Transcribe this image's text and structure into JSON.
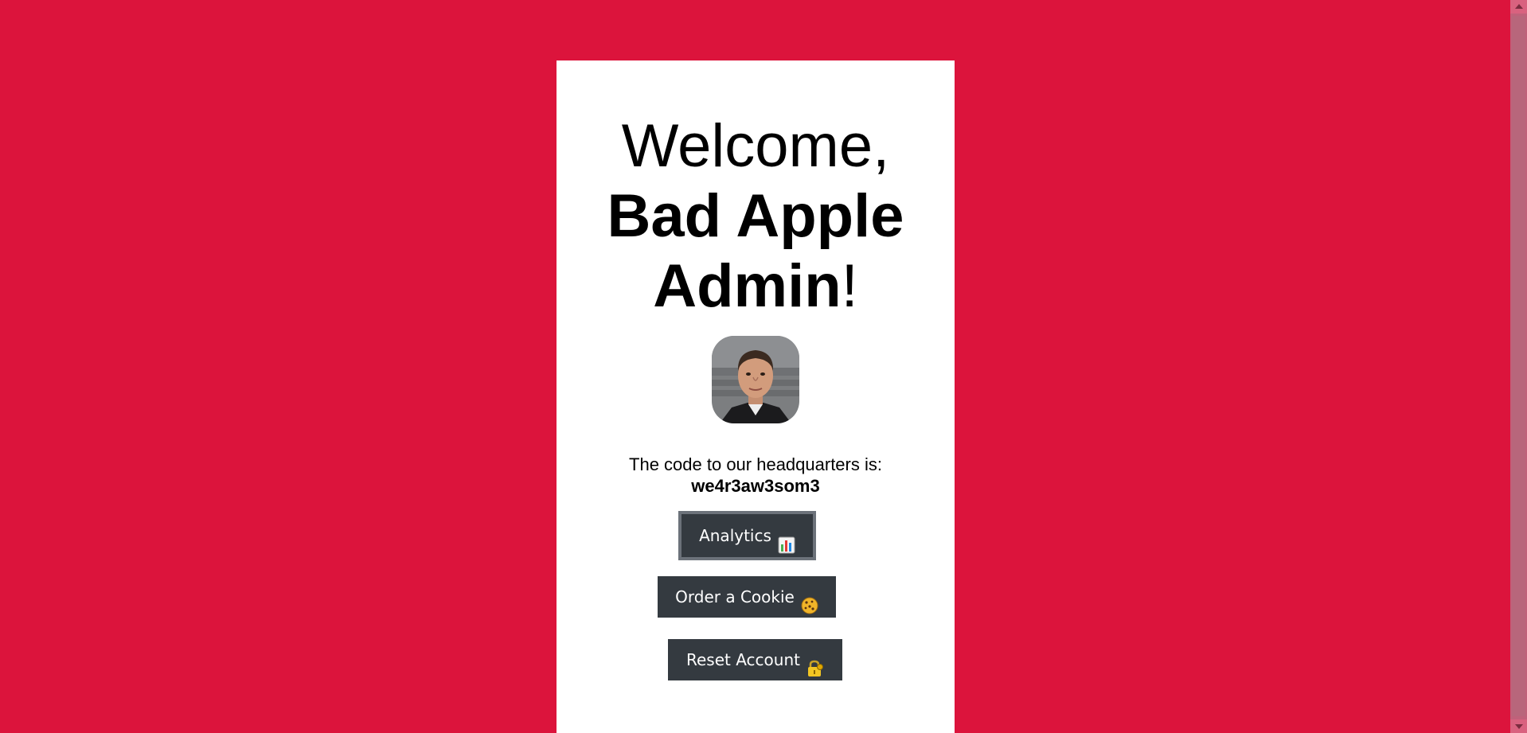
{
  "colors": {
    "background": "#dc143c",
    "card": "#ffffff",
    "button": "#343a40",
    "button_focus_border": "#6c727a"
  },
  "welcome": {
    "greeting": "Welcome,",
    "name": "Bad Apple Admin",
    "exclamation": "!"
  },
  "avatar": {
    "alt": "Admin profile photo"
  },
  "headquarters": {
    "label": "The code to our headquarters is:",
    "code": "we4r3aw3som3"
  },
  "buttons": {
    "analytics": {
      "label": "Analytics",
      "icon": "bar-chart-icon"
    },
    "cookie": {
      "label": "Order a Cookie",
      "icon": "cookie-icon"
    },
    "reset": {
      "label": "Reset Account",
      "icon": "lock-key-icon"
    }
  }
}
